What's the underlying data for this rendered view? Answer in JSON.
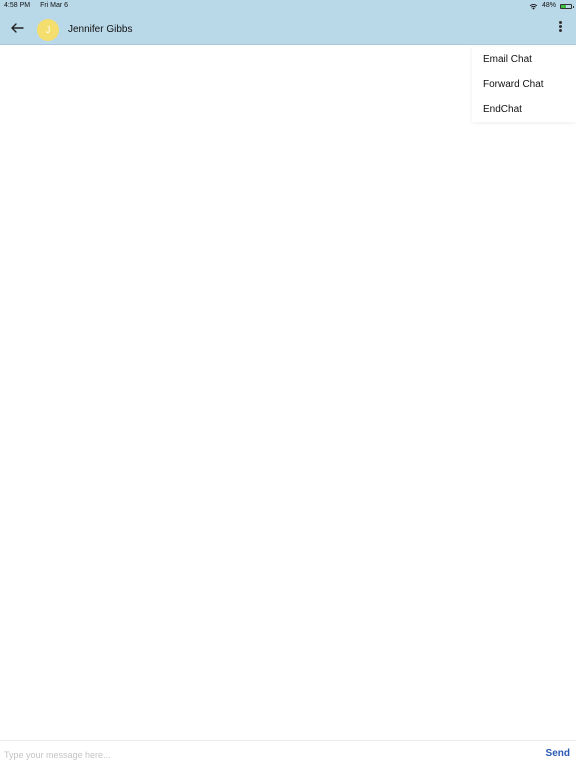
{
  "status_bar": {
    "time": "4:58 PM",
    "date": "Fri Mar 6",
    "battery_text": "48%",
    "battery_level": 0.48,
    "wifi_icon": "wifi-icon",
    "battery_icon": "battery-icon"
  },
  "header": {
    "back_icon": "arrow-left-icon",
    "avatar_initial": "J",
    "avatar_color": "#f3de6e",
    "contact_name": "Jennifer Gibbs",
    "more_icon": "more-vertical-icon",
    "background_color": "#b9d9e9"
  },
  "menu": {
    "items": [
      {
        "label": "Email Chat"
      },
      {
        "label": "Forward Chat"
      },
      {
        "label": "EndChat"
      }
    ]
  },
  "composer": {
    "placeholder": "Type your message here...",
    "value": "",
    "send_label": "Send",
    "send_color": "#2b57b5"
  }
}
